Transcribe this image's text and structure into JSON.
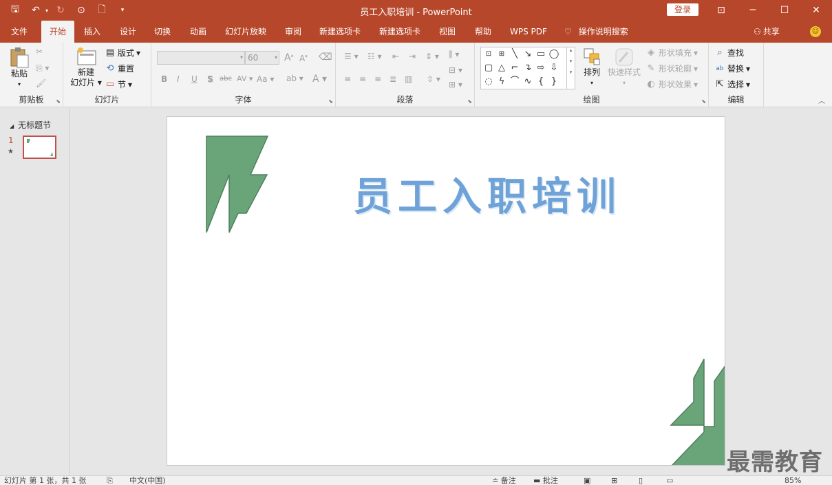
{
  "titlebar": {
    "title": "员工入职培训  -  PowerPoint",
    "login": "登录",
    "qat": [
      {
        "name": "save-icon",
        "glyph": "🖫"
      },
      {
        "name": "undo-icon",
        "glyph": "↶"
      },
      {
        "name": "redo-icon",
        "glyph": "↻"
      },
      {
        "name": "present-icon",
        "glyph": "⊙"
      },
      {
        "name": "new-file-icon",
        "glyph": "🗋"
      },
      {
        "name": "customize-icon",
        "glyph": "≡"
      }
    ],
    "window": {
      "ribbon_options": "⊡",
      "minimize": "─",
      "maximize": "☐",
      "close": "✕"
    }
  },
  "tabs": [
    "文件",
    "开始",
    "插入",
    "设计",
    "切换",
    "动画",
    "幻灯片放映",
    "审阅",
    "新建选项卡",
    "新建选项卡",
    "视图",
    "帮助",
    "WPS PDF"
  ],
  "active_tab": "开始",
  "tell_me": "操作说明搜索",
  "share": "共享",
  "ribbon": {
    "clipboard": {
      "label": "剪贴板",
      "paste": "粘贴"
    },
    "slides": {
      "label": "幻灯片",
      "new_slide_1": "新建",
      "new_slide_2": "幻灯片",
      "layout": "版式",
      "reset": "重置",
      "section": "节"
    },
    "font": {
      "label": "字体",
      "font_name": "",
      "font_size": "60",
      "bold": "B",
      "italic": "I",
      "underline": "U",
      "shadow": "S",
      "strike": "abc",
      "spacing": "AV",
      "case": "Aa",
      "grow": "A",
      "shrink": "A",
      "color": "A"
    },
    "paragraph": {
      "label": "段落"
    },
    "drawing": {
      "label": "绘图",
      "arrange": "排列",
      "quick_styles": "快速样式",
      "fill": "形状填充",
      "outline": "形状轮廓",
      "effects": "形状效果"
    },
    "editing": {
      "label": "编辑",
      "find": "查找",
      "replace": "替换",
      "select": "选择"
    }
  },
  "thumbnails": {
    "section": "无标题节",
    "slide_number": "1"
  },
  "slide": {
    "title": "员工入职培训",
    "accent_color": "#6aa57a",
    "title_color": "#6fa3d8"
  },
  "statusbar": {
    "slide_info": "幻灯片 第 1 张，共 1 张",
    "language": "中文(中国)",
    "notes": "备注",
    "comments": "批注",
    "zoom": "85%"
  },
  "watermark": "最需教育"
}
